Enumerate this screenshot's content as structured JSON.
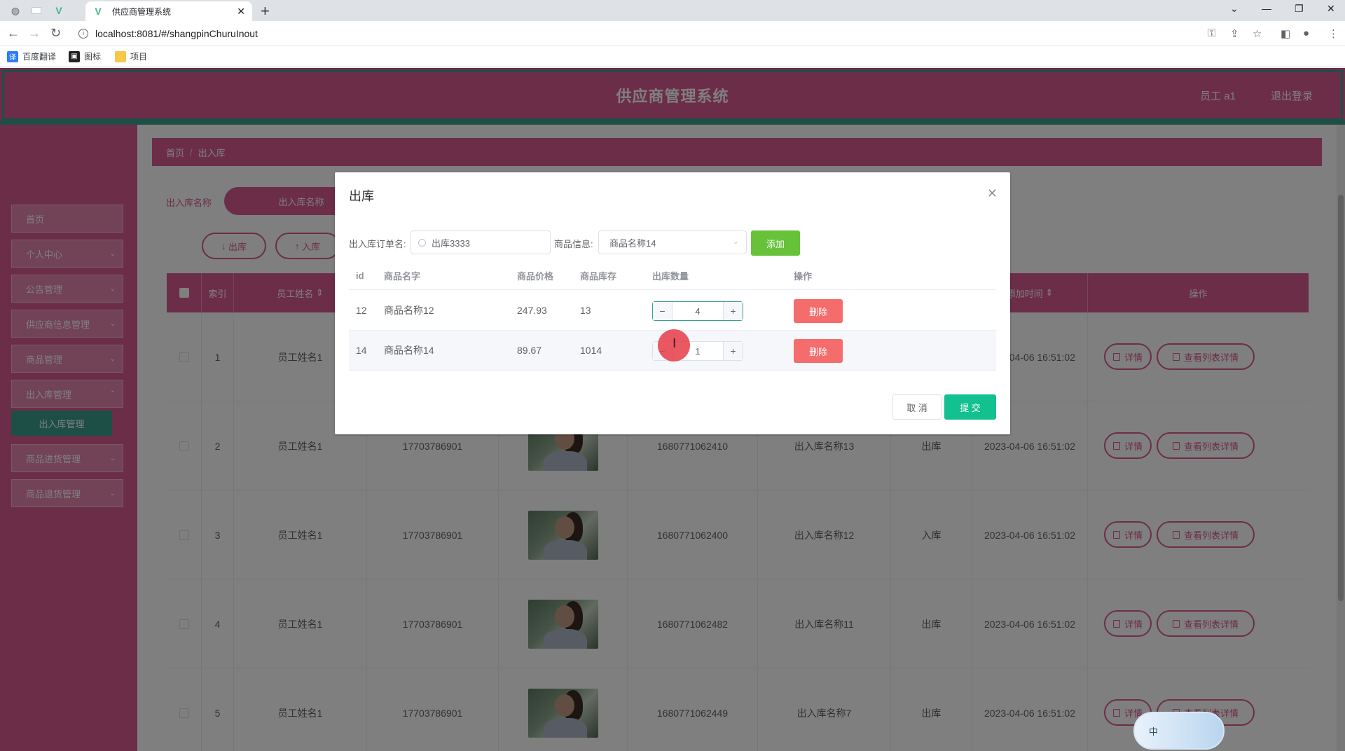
{
  "browser": {
    "tab_title": "供应商管理系统",
    "url": "localhost:8081/#/shangpinChuruInout",
    "bookmarks": [
      "百度翻译",
      "图标",
      "项目"
    ]
  },
  "app": {
    "title": "供应商管理系统",
    "user": "员工 a1",
    "logout": "退出登录"
  },
  "sidebar": {
    "items": [
      {
        "label": "首页"
      },
      {
        "label": "个人中心"
      },
      {
        "label": "公告管理"
      },
      {
        "label": "供应商信息管理"
      },
      {
        "label": "商品管理"
      },
      {
        "label": "出入库管理"
      }
    ],
    "active_sub": "出入库管理",
    "items_after": [
      {
        "label": "商品进货管理"
      },
      {
        "label": "商品退货管理"
      }
    ]
  },
  "content": {
    "breadcrumb": [
      "首页",
      "出入库"
    ],
    "search_label": "出入库名称",
    "search_placeholder": "出入库名称",
    "btn_out": "出库",
    "btn_in": "入库",
    "table": {
      "headers": [
        "索引",
        "员工姓名",
        "添加时间",
        "操作"
      ],
      "rows": [
        {
          "idx": "1",
          "name": "员工姓名1",
          "phone": "",
          "code": "",
          "churu_name": "",
          "type": "",
          "time": "2023-04-06 16:51:02"
        },
        {
          "idx": "2",
          "name": "员工姓名1",
          "phone": "17703786901",
          "code": "1680771062410",
          "churu_name": "出入库名称13",
          "type": "出库",
          "time": "2023-04-06 16:51:02"
        },
        {
          "idx": "3",
          "name": "员工姓名1",
          "phone": "17703786901",
          "code": "1680771062400",
          "churu_name": "出入库名称12",
          "type": "入库",
          "time": "2023-04-06 16:51:02"
        },
        {
          "idx": "4",
          "name": "员工姓名1",
          "phone": "17703786901",
          "code": "1680771062482",
          "churu_name": "出入库名称11",
          "type": "出库",
          "time": "2023-04-06 16:51:02"
        },
        {
          "idx": "5",
          "name": "员工姓名1",
          "phone": "17703786901",
          "code": "1680771062449",
          "churu_name": "出入库名称7",
          "type": "出库",
          "time": "2023-04-06 16:51:02"
        }
      ],
      "row_btn_detail": "详情",
      "row_btn_list": "查看列表详情"
    }
  },
  "dialog": {
    "title": "出库",
    "order_label": "出入库订单名:",
    "order_value": "出库3333",
    "goods_label": "商品信息:",
    "goods_value": "商品名称14",
    "add_btn": "添加",
    "headers": [
      "id",
      "商品名字",
      "商品价格",
      "商品库存",
      "出库数量",
      "操作"
    ],
    "rows": [
      {
        "id": "12",
        "name": "商品名称12",
        "price": "247.93",
        "stock": "13",
        "qty": "4"
      },
      {
        "id": "14",
        "name": "商品名称14",
        "price": "89.67",
        "stock": "1014",
        "qty": "1"
      }
    ],
    "del_btn": "删除",
    "cancel": "取 消",
    "submit": "提 交"
  },
  "ime": {
    "label": "中"
  },
  "colors": {
    "primary": "#d85b91",
    "accent": "#3b9f8f",
    "success": "#67c23a",
    "danger": "#f56c6c",
    "submit": "#13c08f"
  }
}
